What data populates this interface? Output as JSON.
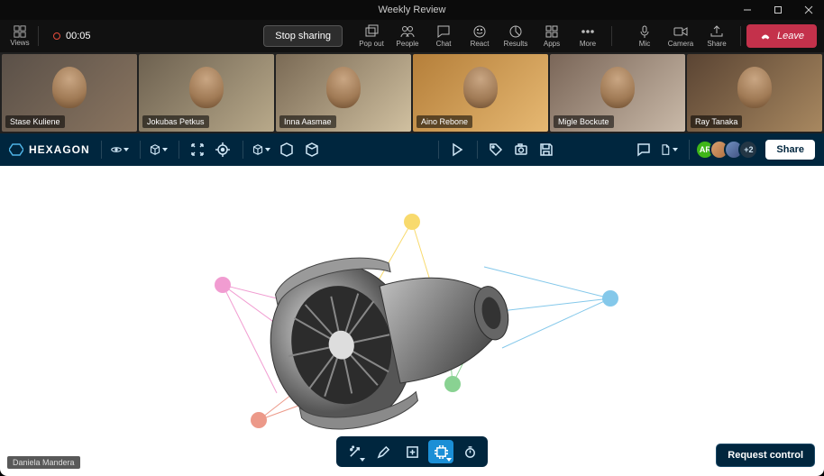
{
  "window": {
    "title": "Weekly Review"
  },
  "meeting": {
    "views_label": "Views",
    "rec_time": "00:05",
    "stop_sharing": "Stop sharing",
    "actions": [
      {
        "id": "popout",
        "label": "Pop out"
      },
      {
        "id": "people",
        "label": "People"
      },
      {
        "id": "chat",
        "label": "Chat"
      },
      {
        "id": "react",
        "label": "React"
      },
      {
        "id": "results",
        "label": "Results"
      },
      {
        "id": "apps",
        "label": "Apps"
      },
      {
        "id": "more",
        "label": "More"
      }
    ],
    "self_controls": [
      {
        "id": "mic",
        "label": "Mic"
      },
      {
        "id": "camera",
        "label": "Camera"
      },
      {
        "id": "share",
        "label": "Share"
      }
    ],
    "leave": "Leave"
  },
  "participants": [
    {
      "name": "Stase Kuliene"
    },
    {
      "name": "Jokubas Petkus"
    },
    {
      "name": "Inna Aasmae"
    },
    {
      "name": "Aino Rebone"
    },
    {
      "name": "Migle Bockute"
    },
    {
      "name": "Ray Tanaka"
    }
  ],
  "app": {
    "brand": "HEXAGON",
    "avatar_initials": "AR",
    "avatar_extra": "+2",
    "share": "Share"
  },
  "footer": {
    "presenter_name": "Daniela Mandera",
    "request_control": "Request control"
  },
  "annotations": [
    {
      "color": "#f4c20d",
      "label": ""
    },
    {
      "color": "#e85cb3",
      "label": ""
    },
    {
      "color": "#e0563b",
      "label": ""
    },
    {
      "color": "#3bb54a",
      "label": ""
    },
    {
      "color": "#33a4dd",
      "label": ""
    }
  ]
}
